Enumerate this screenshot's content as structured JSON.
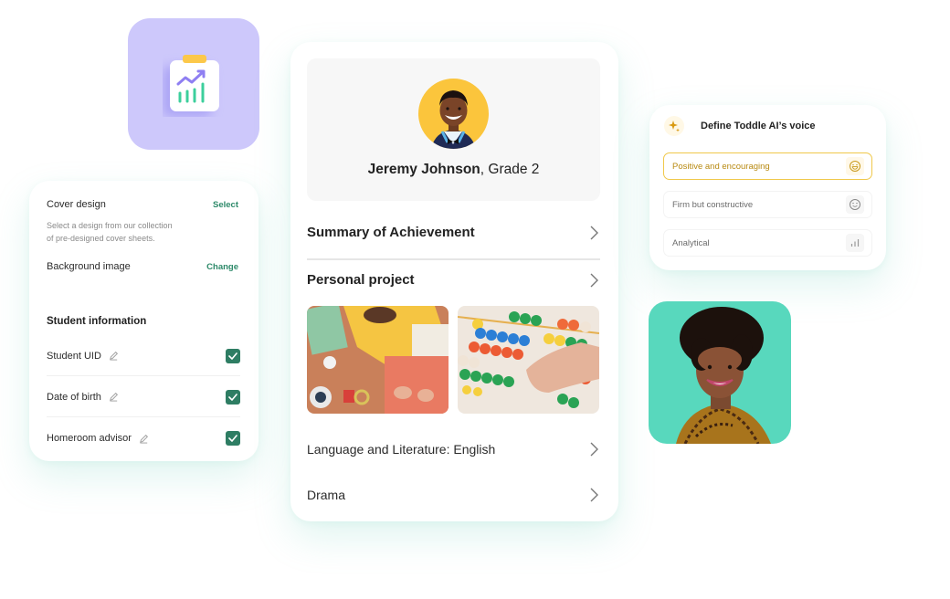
{
  "report_tile": {
    "icon": "clipboard-chart-icon",
    "bg_color": "#cdc8fb"
  },
  "settings_card": {
    "cover_design": {
      "label": "Cover design",
      "action": "Select",
      "description_line1": "Select a design from our collection",
      "description_line2": "of pre-designed cover sheets."
    },
    "background_image": {
      "label": "Background image",
      "action": "Change"
    },
    "student_information": {
      "title": "Student information",
      "fields": [
        {
          "label": "Student UID",
          "checked": true
        },
        {
          "label": "Date of birth",
          "checked": true
        },
        {
          "label": "Homeroom advisor",
          "checked": true
        }
      ]
    },
    "accent_color": "#2e7d63"
  },
  "report_card": {
    "student": {
      "name": "Jeremy Johnson",
      "grade_suffix": ", Grade 2",
      "avatar_bg": "#fbc53c"
    },
    "sections": [
      {
        "label": "Summary of Achievement",
        "bold": true
      },
      {
        "label": "Personal project",
        "bold": true
      },
      {
        "label": "Language and Literature: English",
        "bold": false
      },
      {
        "label": "Drama",
        "bold": false
      }
    ],
    "photos": [
      {
        "alt": "Children doing paper craft"
      },
      {
        "alt": "Child using colorful abacus"
      }
    ]
  },
  "voice_card": {
    "title": "Define Toddle AI’s voice",
    "options": [
      {
        "label": "Positive and encouraging",
        "icon": "grin-face-icon",
        "selected": true
      },
      {
        "label": "Firm but constructive",
        "icon": "smile-face-icon",
        "selected": false
      },
      {
        "label": "Analytical",
        "icon": "bar-chart-icon",
        "selected": false
      }
    ],
    "accent_color": "#f0c84a"
  },
  "teacher_tile": {
    "alt": "Smiling teacher portrait",
    "bg_color": "#58d8bd"
  }
}
